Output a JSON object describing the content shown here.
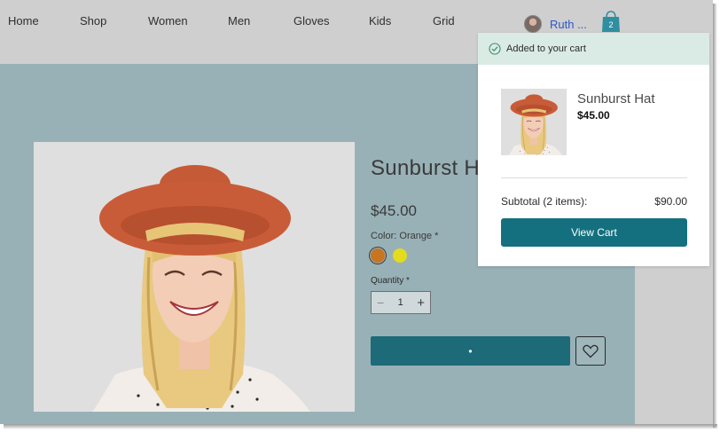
{
  "nav": {
    "items": [
      "Home",
      "Shop",
      "Women",
      "Men",
      "Gloves",
      "Kids",
      "Grid"
    ],
    "user_name": "Ruth ...",
    "cart_count": "2"
  },
  "product": {
    "title": "Sunburst Hat",
    "price": "$45.00",
    "color_label": "Color: Orange *",
    "swatches": [
      {
        "name": "orange",
        "color": "#c9741e",
        "selected": true
      },
      {
        "name": "yellow",
        "color": "#e2dc1c",
        "selected": false
      }
    ],
    "quantity_label": "Quantity *",
    "quantity": "1",
    "add_to_cart_label": "•"
  },
  "popup": {
    "header": "Added to your cart",
    "item_name": "Sunburst Hat",
    "item_price": "$45.00",
    "subtotal_label": "Subtotal (2 items):",
    "subtotal_value": "$90.00",
    "view_cart_label": "View Cart"
  },
  "colors": {
    "accent": "#14707f",
    "stage": "#98b1b6",
    "nav_bg": "#cfcfcf",
    "success_bg": "#d9ebe4"
  }
}
